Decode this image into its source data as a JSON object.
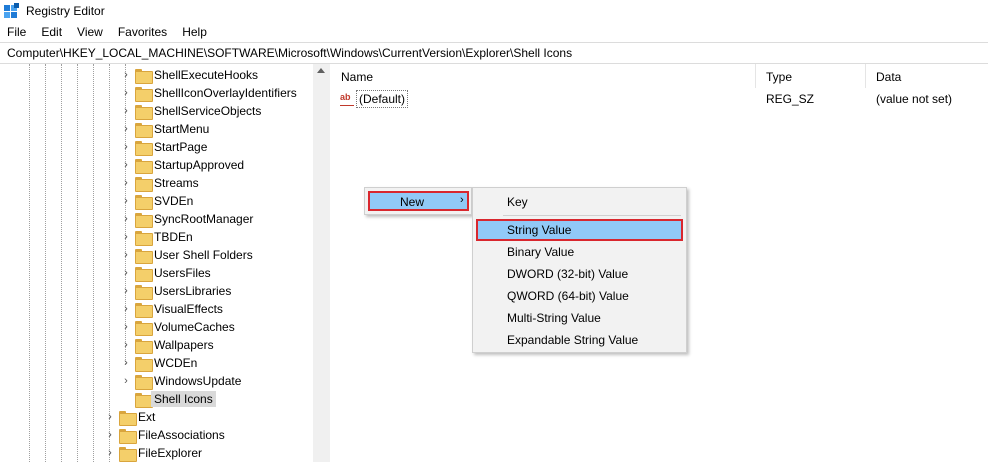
{
  "window": {
    "title": "Registry Editor"
  },
  "menu": [
    "File",
    "Edit",
    "View",
    "Favorites",
    "Help"
  ],
  "address": "Computer\\HKEY_LOCAL_MACHINE\\SOFTWARE\\Microsoft\\Windows\\CurrentVersion\\Explorer\\Shell Icons",
  "tree": {
    "items": [
      "ShellExecuteHooks",
      "ShellIconOverlayIdentifiers",
      "ShellServiceObjects",
      "StartMenu",
      "StartPage",
      "StartupApproved",
      "Streams",
      "SVDEn",
      "SyncRootManager",
      "TBDEn",
      "User Shell Folders",
      "UsersFiles",
      "UsersLibraries",
      "VisualEffects",
      "VolumeCaches",
      "Wallpapers",
      "WCDEn",
      "WindowsUpdate",
      "Shell Icons",
      "Ext",
      "FileAssociations",
      "FileExplorer"
    ]
  },
  "list": {
    "columns": [
      "Name",
      "Type",
      "Data"
    ],
    "rows": [
      {
        "name": "(Default)",
        "type": "REG_SZ",
        "data": "(value not set)",
        "icon": "string-value-icon"
      }
    ]
  },
  "context_menu": {
    "new_label": "New",
    "submenu": [
      "Key",
      "String Value",
      "Binary Value",
      "DWORD (32-bit) Value",
      "QWORD (64-bit) Value",
      "Multi-String Value",
      "Expandable String Value"
    ],
    "highlight_color": "#91c9f7",
    "outline_color": "#d9272e"
  }
}
